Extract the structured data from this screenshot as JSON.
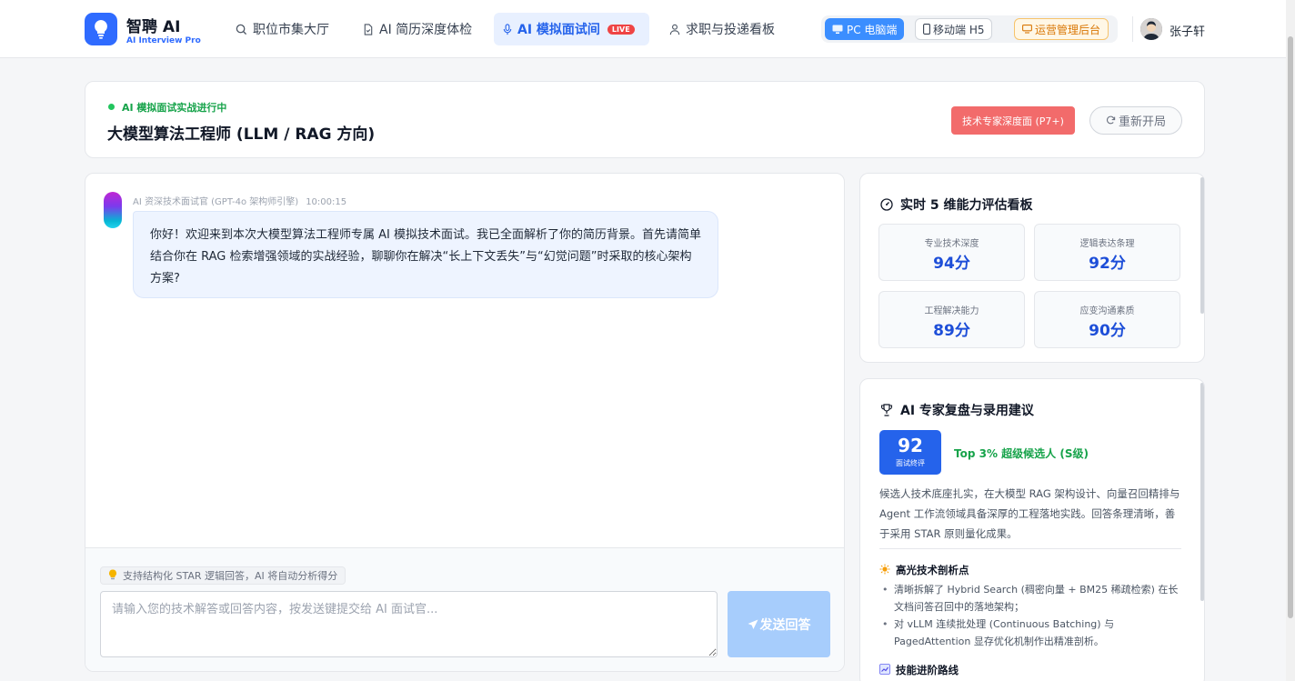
{
  "brand": {
    "name": "智聘 AI",
    "subtitle": "AI Interview Pro",
    "color": "#2f6bff",
    "icon": "lightbulb-icon"
  },
  "nav": [
    {
      "label": "职位市集大厅",
      "icon": "search-icon",
      "active": false
    },
    {
      "label": "AI 简历深度体检",
      "icon": "file-check-icon",
      "active": false
    },
    {
      "label": "AI 模拟面试间",
      "icon": "microphone-icon",
      "active": true,
      "badge": "LIVE"
    },
    {
      "label": "求职与投递看板",
      "icon": "user-icon",
      "active": false
    }
  ],
  "mode_switch": {
    "pc": "PC 电脑端",
    "h5": "移动端 H5",
    "ops": "运营管理后台"
  },
  "user": {
    "name": "张子轩"
  },
  "session": {
    "status": "AI 模拟面试实战进行中",
    "title": "大模型算法工程师 (LLM / RAG 方向)",
    "level_tag": "技术专家深度面 (P7+)",
    "restart_label": "重新开局"
  },
  "chat": {
    "messages": [
      {
        "sender": "AI 资深技术面试官 (GPT-4o 架构师引擎)",
        "time": "10:00:15",
        "text": "你好！欢迎来到本次大模型算法工程师专属 AI 模拟技术面试。我已全面解析了你的简历背景。首先请简单结合你在 RAG 检索增强领域的实战经验，聊聊你在解决“长上下文丢失”与“幻觉问题”时采取的核心架构方案?"
      }
    ],
    "hint": "支持结构化 STAR 逻辑回答，AI 将自动分析得分",
    "input_placeholder": "请输入您的技术解答或回答内容，按发送键提交给 AI 面试官...",
    "input_value": "",
    "send_label": "发送回答"
  },
  "ability_board": {
    "title": "实时 5 维能力评估看板",
    "scores": [
      {
        "label": "专业技术深度",
        "value": "94分"
      },
      {
        "label": "逻辑表达条理",
        "value": "92分"
      },
      {
        "label": "工程解决能力",
        "value": "89分"
      },
      {
        "label": "应变沟通素质",
        "value": "90分"
      }
    ]
  },
  "review": {
    "title": "AI 专家复盘与录用建议",
    "score": "92",
    "score_label": "面试终评",
    "rank": "Top 3% 超级候选人 (S级)",
    "summary": "候选人技术底座扎实，在大模型 RAG 架构设计、向量召回精排与 Agent 工作流领域具备深厚的工程落地实践。回答条理清晰，善于采用 STAR 原则量化成果。",
    "highlights_title": "高光技术剖析点",
    "highlights": [
      "清晰拆解了 Hybrid Search (稠密向量 + BM25 稀疏检索) 在长文档问答召回中的落地架构；",
      "对 vLLM 连续批处理 (Continuous Batching) 与 PagedAttention 显存优化机制作出精准剖析。"
    ],
    "path_title": "技能进阶路线"
  }
}
